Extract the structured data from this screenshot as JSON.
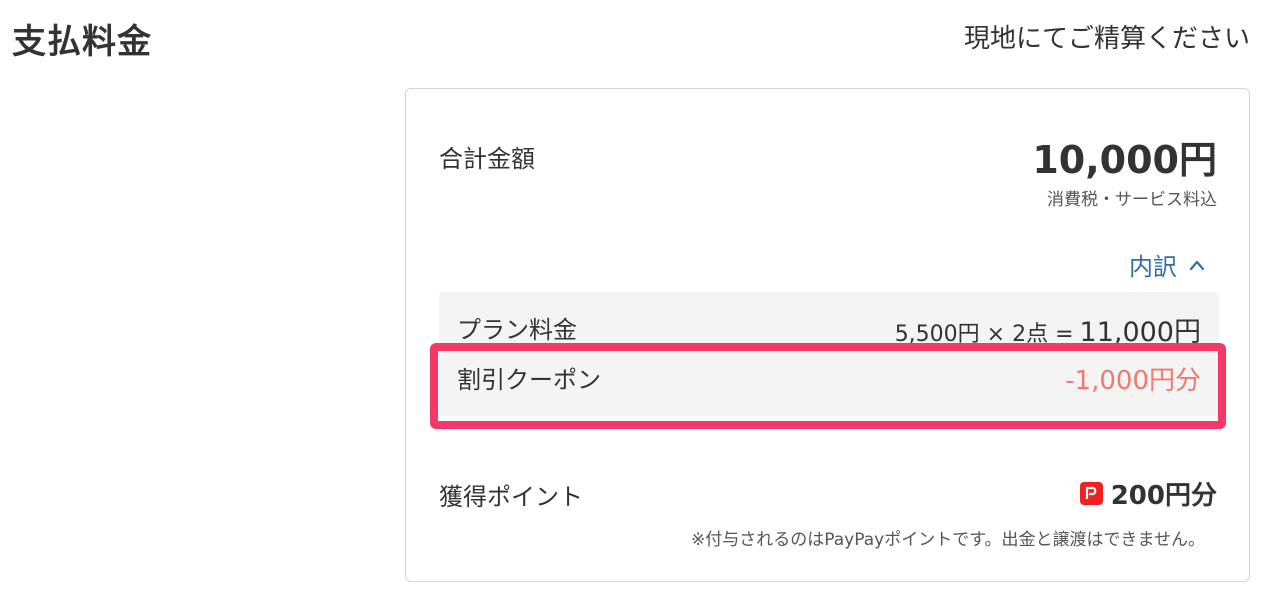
{
  "page": {
    "title": "支払料金",
    "payment_note": "現地にてご精算ください"
  },
  "summary": {
    "total_label": "合計金額",
    "total_amount": "10,000円",
    "tax_note": "消費税・サービス料込",
    "breakdown_toggle_label": "内訳"
  },
  "breakdown": {
    "plan": {
      "label": "プラン料金",
      "formula": "5,500円 × 2点 =",
      "subtotal": "11,000円"
    },
    "coupon": {
      "label": "割引クーポン",
      "value": "-1,000円分"
    }
  },
  "points": {
    "label": "獲得ポイント",
    "icon": "paypay-icon",
    "value": "200円分",
    "note": "※付与されるのはPayPayポイントです。出金と譲渡はできません。"
  },
  "colors": {
    "link": "#2f6ea8",
    "discount": "#f07a6d",
    "highlight": "#f43868",
    "paypay": "#ee2222"
  }
}
